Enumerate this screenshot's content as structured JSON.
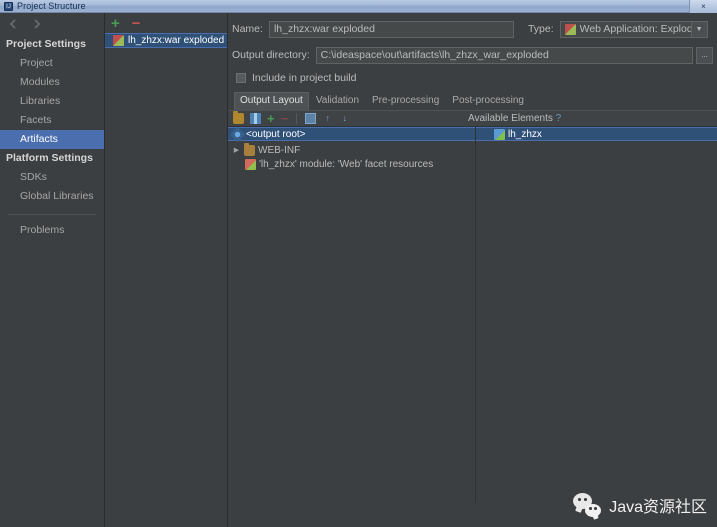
{
  "window": {
    "title": "Project Structure",
    "app_icon": "intellij-idea-icon",
    "close_label": "×"
  },
  "sidebar": {
    "nav_back": "back-arrow",
    "nav_forward": "forward-arrow",
    "groups": [
      {
        "label": "Project Settings",
        "items": [
          {
            "label": "Project",
            "selected": false
          },
          {
            "label": "Modules",
            "selected": false
          },
          {
            "label": "Libraries",
            "selected": false
          },
          {
            "label": "Facets",
            "selected": false
          },
          {
            "label": "Artifacts",
            "selected": true
          }
        ]
      },
      {
        "label": "Platform Settings",
        "items": [
          {
            "label": "SDKs",
            "selected": false
          },
          {
            "label": "Global Libraries",
            "selected": false
          }
        ]
      }
    ],
    "problems": "Problems"
  },
  "artifacts_panel": {
    "add_label": "+",
    "remove_label": "−",
    "items": [
      {
        "label": "lh_zhzx:war exploded",
        "icon": "war-artifact-icon",
        "selected": true
      }
    ]
  },
  "main": {
    "name_label": "Name:",
    "name_value": "lh_zhzx:war exploded",
    "type_label": "Type:",
    "type_value": "Web Application: Exploded",
    "type_icon": "war-artifact-icon",
    "output_dir_label": "Output directory:",
    "output_dir_value": "C:\\ideaspace\\out\\artifacts\\lh_zhzx_war_exploded",
    "browse_label": "...",
    "include_in_build_label": "Include in project build",
    "include_in_build_checked": false,
    "tabs": [
      {
        "label": "Output Layout",
        "active": true
      },
      {
        "label": "Validation",
        "active": false
      },
      {
        "label": "Pre-processing",
        "active": false
      },
      {
        "label": "Post-processing",
        "active": false
      }
    ],
    "toolbar": {
      "create_directory": "create-directory-icon",
      "create_archive": "create-archive-icon",
      "add": "+",
      "remove": "−",
      "extract_into": "extract-into-output-root-icon",
      "move_up": "↑",
      "move_down": "↓"
    },
    "output_tree": [
      {
        "label": "<output root>",
        "icon": "artifact-output-root-icon",
        "expander": "",
        "indent": 0,
        "selected": true
      },
      {
        "label": "WEB-INF",
        "icon": "folder-icon",
        "expander": "▶",
        "indent": 0,
        "selected": false
      },
      {
        "label": "'lh_zhzx' module: 'Web' facet resources",
        "icon": "web-facet-icon",
        "expander": "",
        "indent": 1,
        "selected": false
      }
    ],
    "available_elements_label": "Available Elements",
    "available_help": "?",
    "available_tree": [
      {
        "label": "lh_zhzx",
        "icon": "module-icon",
        "selected": true
      }
    ]
  },
  "watermark": {
    "text": "Java资源社区",
    "icon": "wechat-icon"
  },
  "colors": {
    "background": "#3c3f41",
    "selection_blue": "#4b6eaf",
    "tree_selection": "#2f5178",
    "text": "#bbbbbb",
    "accent_green": "#499c54",
    "accent_red": "#c75450",
    "link_blue": "#6897bb"
  }
}
